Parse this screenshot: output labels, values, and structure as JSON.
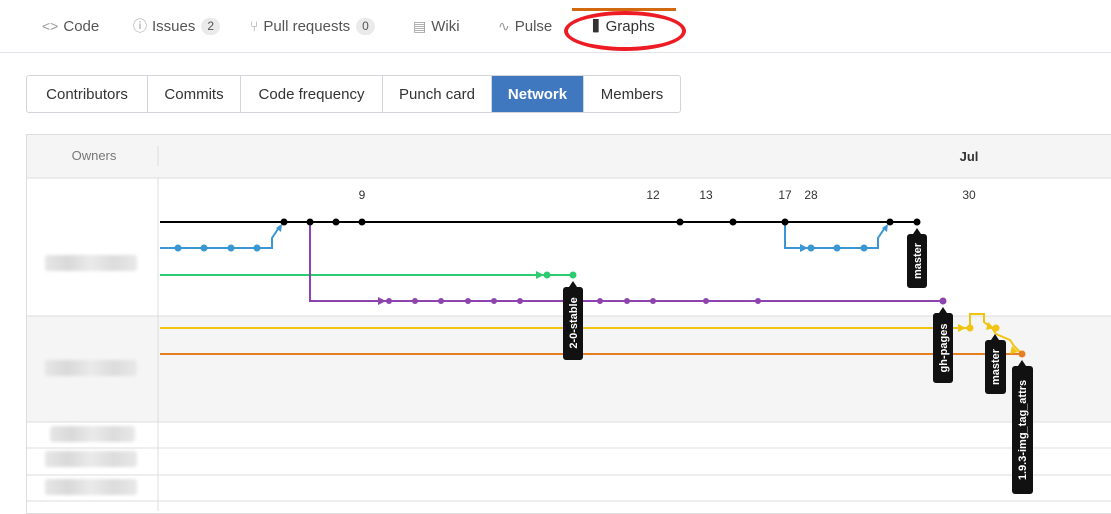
{
  "repo_nav": {
    "tabs": [
      {
        "icon": "code-icon",
        "glyph": "<>",
        "label": "Code"
      },
      {
        "icon": "issue-icon",
        "glyph": "ⓘ",
        "label": "Issues",
        "count": "2"
      },
      {
        "icon": "pull-request-icon",
        "glyph": "⑂",
        "label": "Pull requests",
        "count": "0"
      },
      {
        "icon": "wiki-icon",
        "glyph": "▤",
        "label": "Wiki"
      },
      {
        "icon": "pulse-icon",
        "glyph": "∿",
        "label": "Pulse"
      },
      {
        "icon": "graph-icon",
        "glyph": "▐▌",
        "label": "Graphs"
      }
    ],
    "active": "Graphs"
  },
  "subnav": {
    "items": [
      "Contributors",
      "Commits",
      "Code frequency",
      "Punch card",
      "Network",
      "Members"
    ],
    "selected": "Network"
  },
  "network": {
    "owners_header": "Owners",
    "month": "Jul",
    "day_labels": [
      "9",
      "12",
      "13",
      "17",
      "28",
      "30"
    ],
    "branch_labels": [
      "master",
      "2-0-stable",
      "gh-pages",
      "master",
      "1.9.3-img_tag_attrs"
    ],
    "colors": {
      "black": "#000000",
      "blue": "#3a97d3",
      "green": "#2ecc71",
      "purple": "#8e44ad",
      "yellow": "#f1c40f",
      "orange": "#e67e22"
    }
  }
}
